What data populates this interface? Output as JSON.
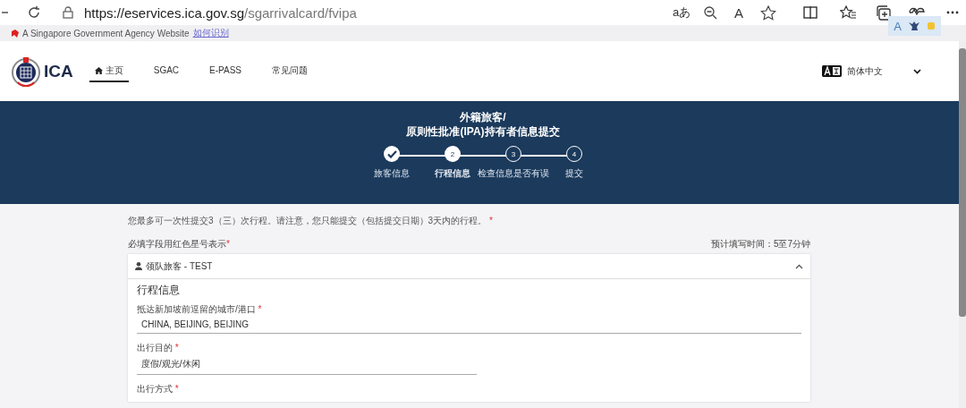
{
  "browser": {
    "url_host": "https://eservices.ica.gov.sg",
    "url_path": "/sgarrivalcard/fvipa",
    "translate_glyph": "aあ",
    "read_glyph": "A",
    "ext_glyph": "A"
  },
  "gov_banner": {
    "text": "A Singapore Government Agency Website",
    "link": "如何识别"
  },
  "header": {
    "logo": "ICA",
    "nav": [
      {
        "label": "主页",
        "selected": true
      },
      {
        "label": "SGAC",
        "selected": false
      },
      {
        "label": "E-PASS",
        "selected": false
      },
      {
        "label": "常见问题",
        "selected": false
      }
    ],
    "language": "简体中文"
  },
  "hero": {
    "title_line1": "外籍旅客/",
    "title_line2": "原则性批准(IPA)持有者信息提交",
    "steps": [
      {
        "label": "旅客信息",
        "done": true,
        "selected": false
      },
      {
        "number": "2",
        "label": "行程信息",
        "done": false,
        "selected": true
      },
      {
        "number": "3",
        "label": "检查信息是否有误",
        "done": false,
        "selected": false
      },
      {
        "number": "4",
        "label": "提交",
        "done": false,
        "selected": false
      }
    ]
  },
  "intro": {
    "text": "您最多可一次性提交3（三）次行程。请注意，您只能提交（包括提交日期）3天内的行程。",
    "mark": "*"
  },
  "required_note": {
    "text": "必填字段用红色星号表示",
    "mark": "*"
  },
  "time_note": "预计填写时间：5至7分钟",
  "traveller": {
    "name": "领队旅客 - TEST",
    "expanded": true
  },
  "section_title": "行程信息",
  "fields": [
    {
      "label": "抵达新加坡前逗留的城市/港口",
      "mark": "*",
      "value": "CHINA, BEIJING, BEIJING",
      "kind": "text"
    },
    {
      "label": "出行目的",
      "mark": "*",
      "value": "度假/观光/休闲",
      "kind": "select"
    },
    {
      "label": "出行方式",
      "mark": "*",
      "kind": "label_only"
    }
  ]
}
